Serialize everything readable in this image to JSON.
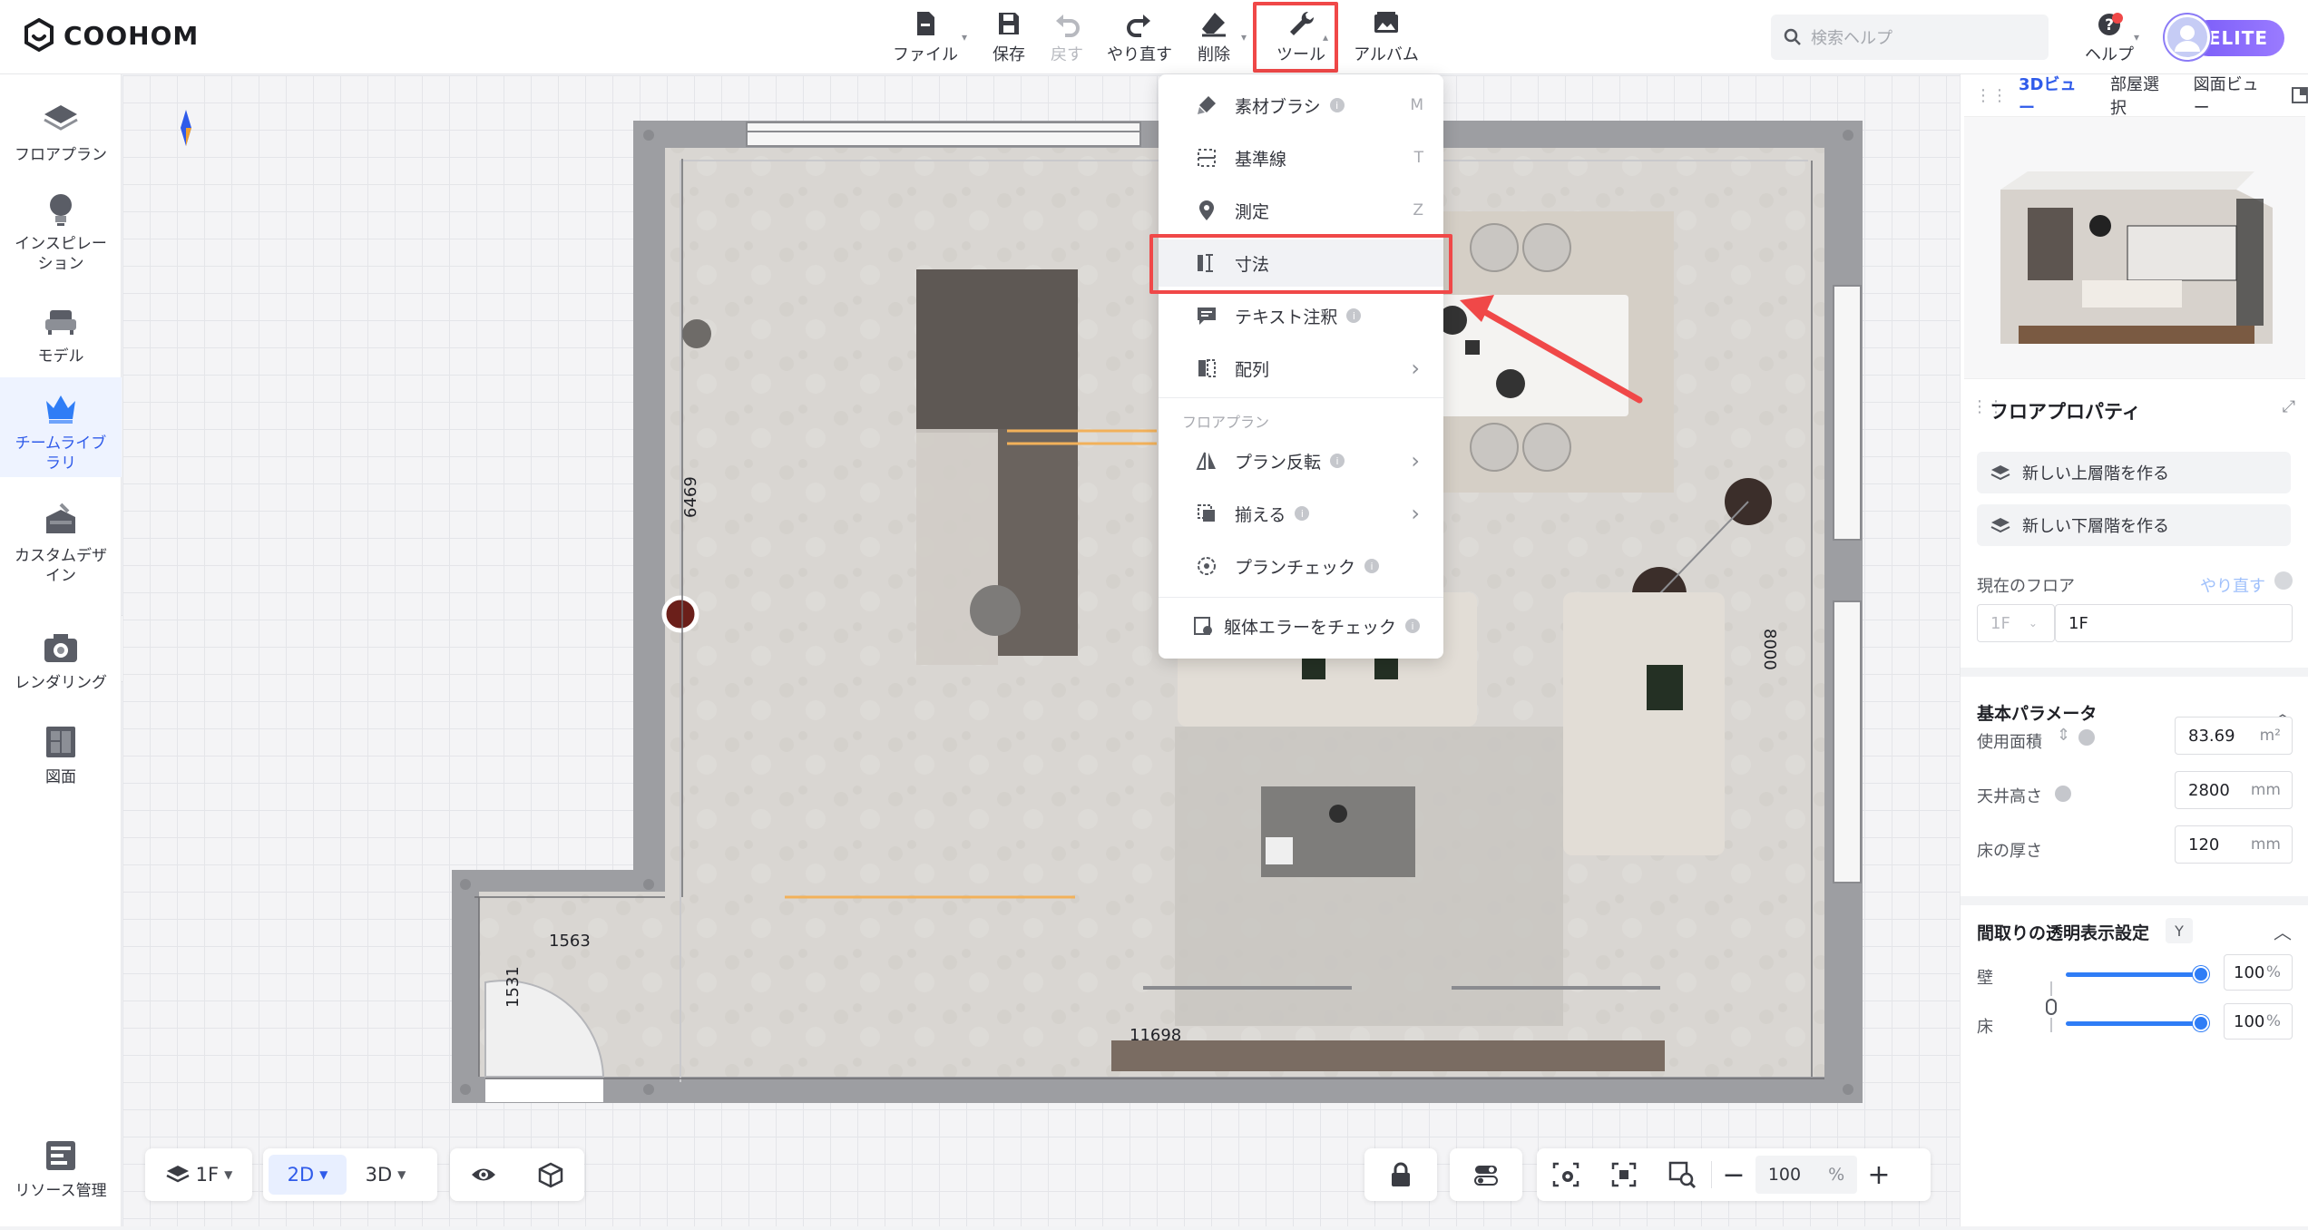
{
  "app": {
    "brand": "COOHOM"
  },
  "toolbar": {
    "file_label": "ファイル",
    "save_label": "保存",
    "undo_label": "戻す",
    "redo_label": "やり直す",
    "delete_label": "削除",
    "tools_label": "ツール",
    "album_label": "アルバム"
  },
  "search": {
    "placeholder": "検索ヘルプ"
  },
  "help_label": "ヘルプ",
  "badge_label": "ELITE",
  "sidebar": {
    "items": [
      {
        "label": "フロアプラン"
      },
      {
        "label": "インスピレーション"
      },
      {
        "label": "モデル"
      },
      {
        "label": "チームライブラリ"
      },
      {
        "label": "カスタムデザイン"
      },
      {
        "label": "レンダリング"
      },
      {
        "label": "図面"
      },
      {
        "label": "リソース管理"
      }
    ]
  },
  "tools_menu": {
    "items": [
      {
        "label": "素材ブラシ",
        "key": "M"
      },
      {
        "label": "基準線",
        "key": "T"
      },
      {
        "label": "測定",
        "key": "Z"
      },
      {
        "label": "寸法",
        "key": ""
      },
      {
        "label": "テキスト注釈",
        "key": ""
      },
      {
        "label": "配列",
        "key": ""
      }
    ],
    "group_label": "フロアプラン",
    "group_items": [
      {
        "label": "プラン反転"
      },
      {
        "label": "揃える"
      },
      {
        "label": "プランチェック"
      }
    ],
    "footer_item": {
      "label": "躯体エラーをチェック"
    }
  },
  "dimensions": {
    "d6469": "6469",
    "d8000": "8000",
    "d1563": "1563",
    "d1531": "1531",
    "d11698": "11698"
  },
  "right_panel": {
    "tabs": [
      "3Dビュー",
      "部屋選択",
      "図面ビュー"
    ],
    "title": "フロアプロパティ",
    "new_upper_floor": "新しい上層階を作る",
    "new_lower_floor": "新しい下層階を作る",
    "current_floor_label": "現在のフロア",
    "redo_link": "やり直す",
    "floor_select": "1F",
    "floor_name": "1F",
    "basic_params_title": "基本パラメータ",
    "area_label": "使用面積",
    "area_value": "83.69",
    "area_unit": "m²",
    "ceiling_label": "天井高さ",
    "ceiling_value": "2800",
    "ceiling_unit": "mm",
    "floor_thickness_label": "床の厚さ",
    "floor_thickness_value": "120",
    "floor_thickness_unit": "mm",
    "transparency_title": "間取りの透明表示設定",
    "transparency_key": "Y",
    "wall_label": "壁",
    "wall_value": "100",
    "floor_label": "床",
    "floor_value": "100",
    "percent": "%"
  },
  "bottom_bar": {
    "floor": "1F",
    "mode_2d": "2D",
    "mode_3d": "3D",
    "zoom": "100",
    "zoom_unit": "%",
    "minus": "−",
    "plus": "+"
  },
  "colors": {
    "accent": "#2f5bea",
    "highlight": "#f04848",
    "arrow": "#f04848"
  }
}
